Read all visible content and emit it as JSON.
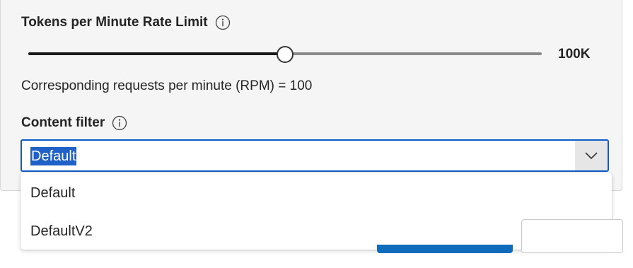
{
  "tpm": {
    "label": "Tokens per Minute Rate Limit",
    "info_icon": "info-icon",
    "slider_fraction": 0.498,
    "value_label": "100K"
  },
  "rpm_text": "Corresponding requests per minute (RPM) = 100",
  "content_filter": {
    "label": "Content filter",
    "info_icon": "info-icon",
    "selected": "Default",
    "chevron_icon": "chevron-down-icon",
    "options": [
      "Default",
      "DefaultV2"
    ]
  },
  "colors": {
    "panel_bg": "#f5f5f5",
    "focus_border": "#0f5bc7",
    "selection_highlight": "#1f61c7",
    "primary_button": "#0f6cbd"
  }
}
